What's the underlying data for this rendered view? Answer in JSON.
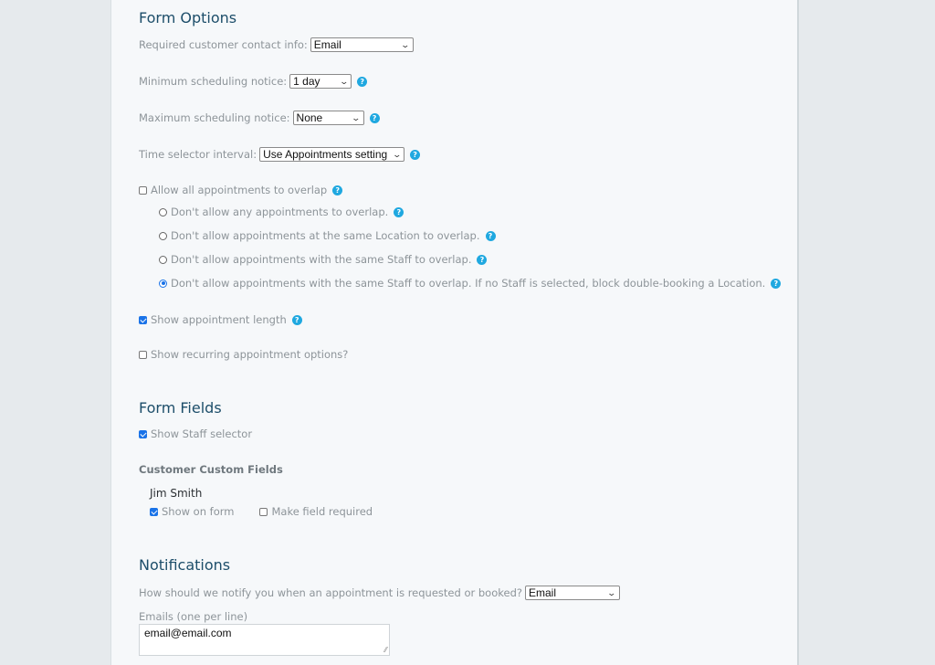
{
  "form_options": {
    "title": "Form Options",
    "required_contact": {
      "label": "Required customer contact info:",
      "value": "Email"
    },
    "min_notice": {
      "label": "Minimum scheduling notice:",
      "value": "1 day"
    },
    "max_notice": {
      "label": "Maximum scheduling notice:",
      "value": "None"
    },
    "time_interval": {
      "label": "Time selector interval:",
      "value": "Use Appointments setting"
    },
    "allow_overlap": {
      "label": "Allow all appointments to overlap",
      "checked": false
    },
    "overlap_options": [
      {
        "label": "Don't allow any appointments to overlap.",
        "selected": false
      },
      {
        "label": "Don't allow appointments at the same Location to overlap.",
        "selected": false
      },
      {
        "label": "Don't allow appointments with the same Staff to overlap.",
        "selected": false
      },
      {
        "label": "Don't allow appointments with the same Staff to overlap. If no Staff is selected, block double-booking a Location.",
        "selected": true
      }
    ],
    "show_length": {
      "label": "Show appointment length",
      "checked": true
    },
    "show_recurring": {
      "label": "Show recurring appointment options?",
      "checked": false
    },
    "help_icon": "?"
  },
  "form_fields": {
    "title": "Form Fields",
    "show_staff": {
      "label": "Show Staff selector",
      "checked": true
    },
    "custom_fields_title": "Customer Custom Fields",
    "custom_fields": [
      {
        "name": "Jim Smith",
        "show_on_form": {
          "label": "Show on form",
          "checked": true
        },
        "required": {
          "label": "Make field required",
          "checked": false
        }
      }
    ]
  },
  "notifications": {
    "title": "Notifications",
    "method": {
      "label": "How should we notify you when an appointment is requested or booked?",
      "value": "Email"
    },
    "emails": {
      "label": "Emails (one per line)",
      "value": "email@email.com"
    }
  },
  "icons": {
    "chevron": "⌄",
    "resize": "⁄⁄"
  }
}
